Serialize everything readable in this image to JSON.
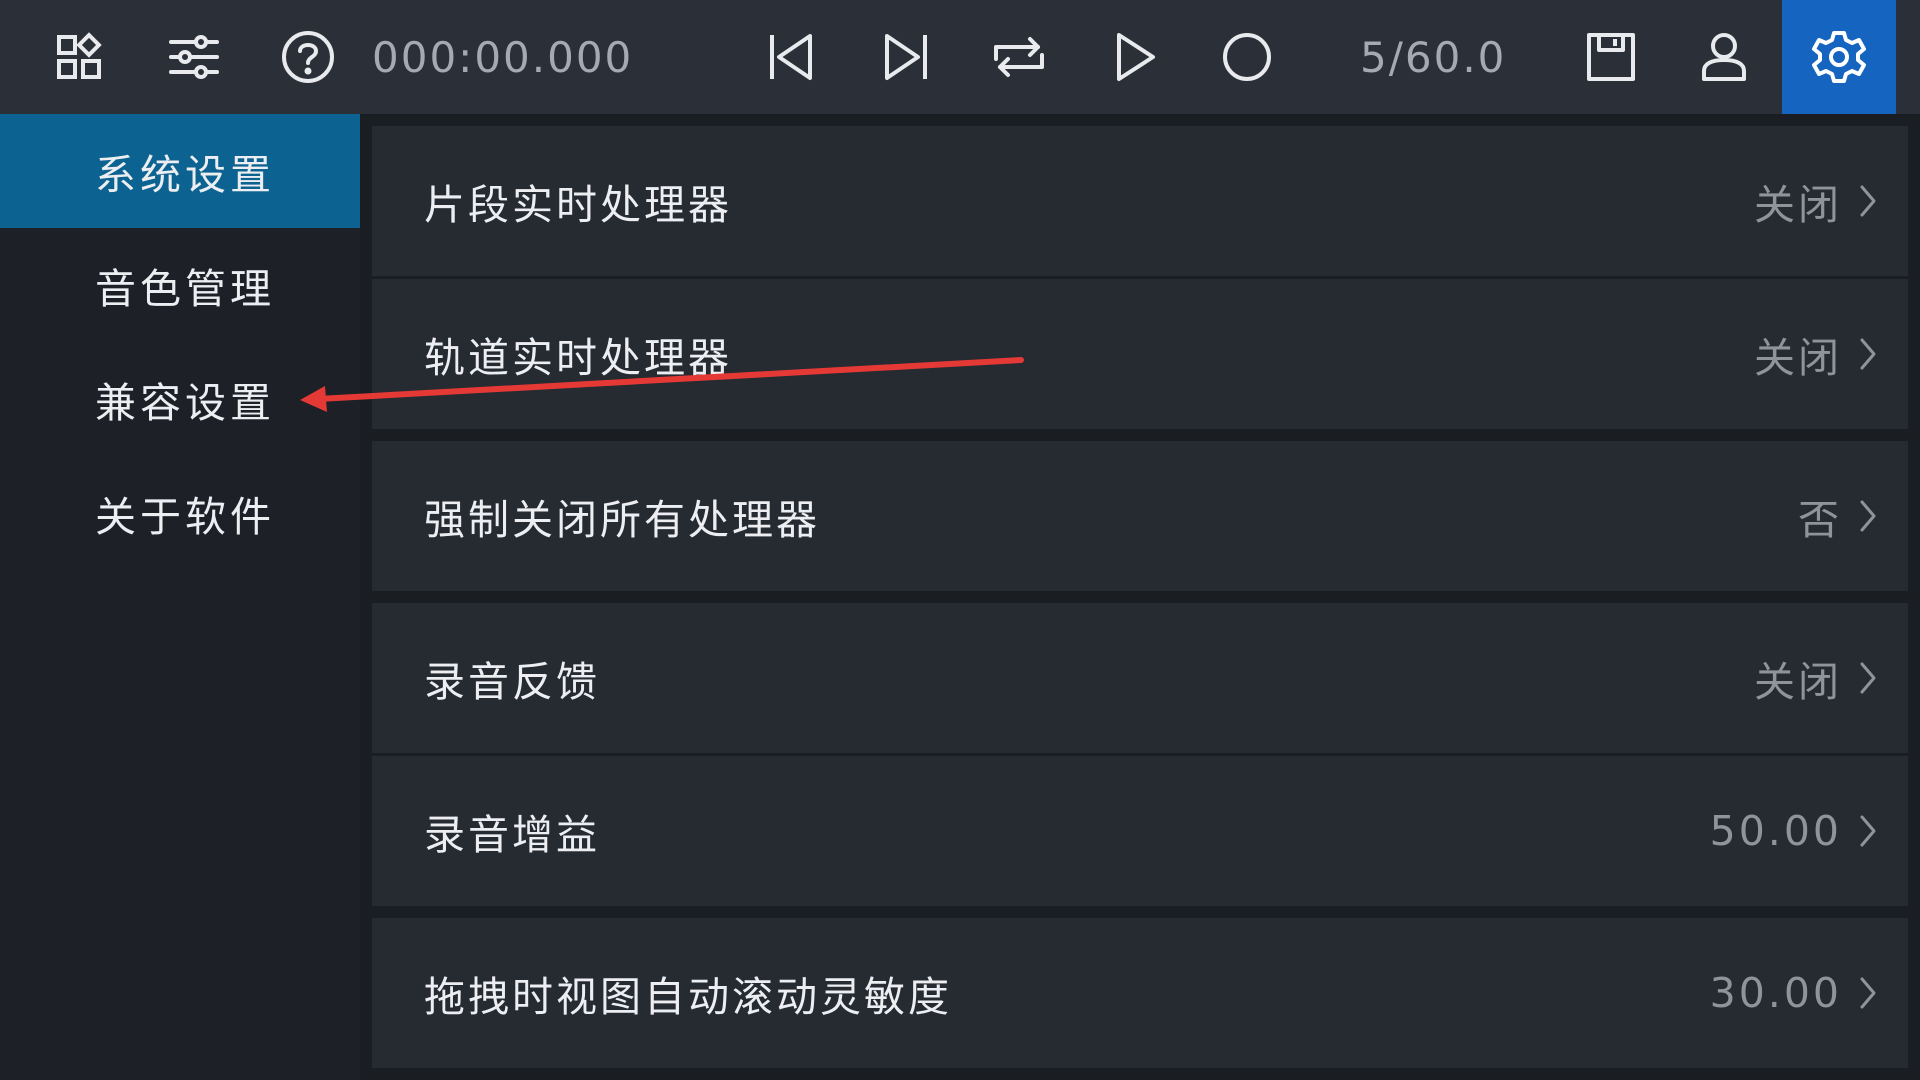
{
  "toolbar": {
    "time_display": "000:00.000",
    "position_display": "5/60.0",
    "icons": [
      "grid-icon",
      "sliders-icon",
      "help-icon",
      "skip-back-icon",
      "skip-forward-icon",
      "loop-icon",
      "play-icon",
      "record-icon",
      "save-icon",
      "user-icon",
      "settings-icon"
    ],
    "active_icon": "settings-icon"
  },
  "sidebar": {
    "items": [
      {
        "label": "系统设置",
        "active": true
      },
      {
        "label": "音色管理",
        "active": false
      },
      {
        "label": "兼容设置",
        "active": false
      },
      {
        "label": "关于软件",
        "active": false
      }
    ]
  },
  "settings": {
    "rows": [
      {
        "label": "片段实时处理器",
        "value": "关闭"
      },
      {
        "label": "轨道实时处理器",
        "value": "关闭"
      },
      {
        "label": "强制关闭所有处理器",
        "value": "否"
      },
      {
        "label": "录音反馈",
        "value": "关闭"
      },
      {
        "label": "录音增益",
        "value": "50.00"
      },
      {
        "label": "拖拽时视图自动滚动灵敏度",
        "value": "30.00"
      }
    ]
  },
  "colors": {
    "toolbar_bg": "#2b3038",
    "active_toolbar": "#1565c0",
    "sidebar_active": "#0c6290",
    "row_bg": "#262a31",
    "annotation_arrow": "#e53935"
  }
}
